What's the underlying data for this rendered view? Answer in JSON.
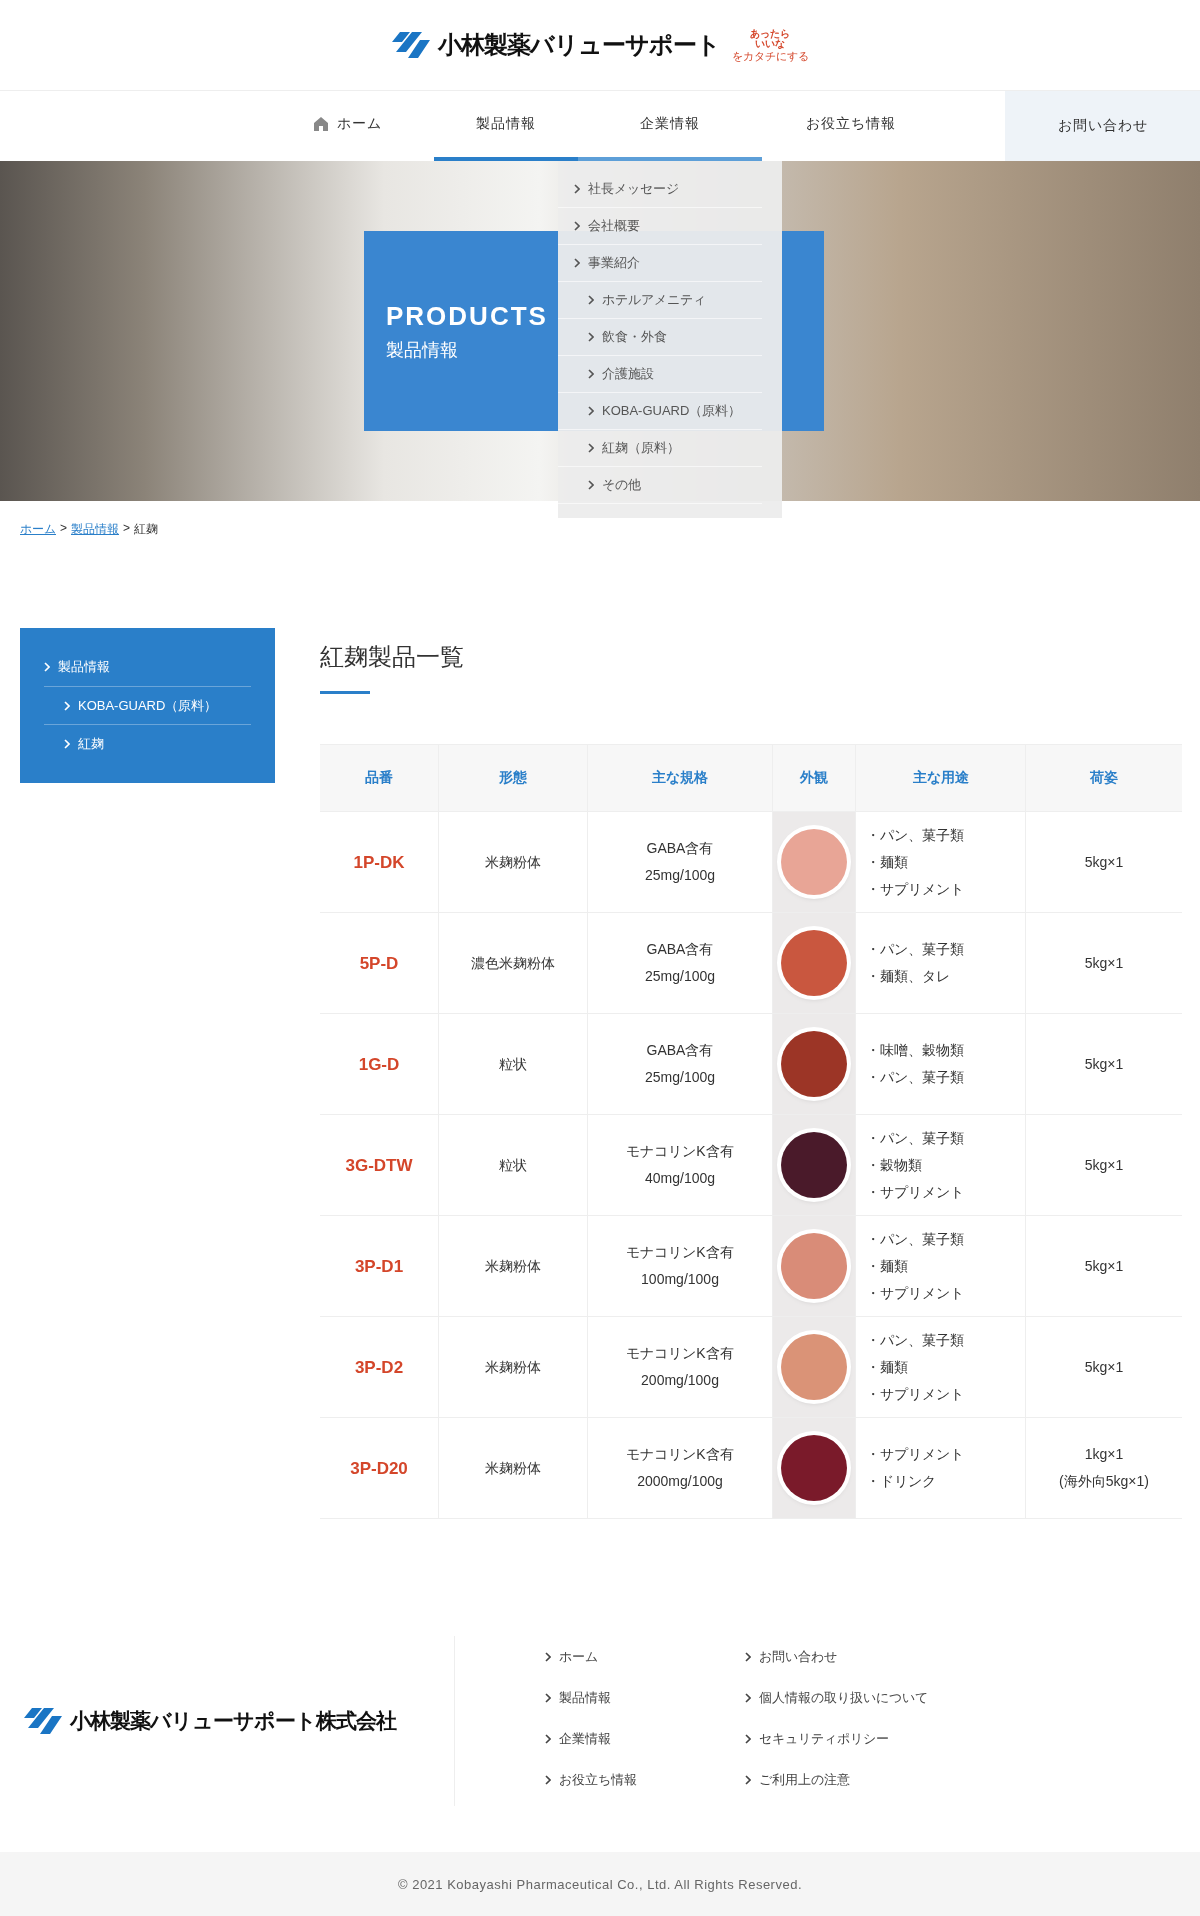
{
  "header": {
    "logo_text": "小林製薬バリューサポート",
    "badge_lines": [
      "あったら",
      "いいな",
      "をカタチにする"
    ]
  },
  "nav": {
    "items": [
      {
        "label": "ホーム",
        "kind": "home",
        "selected": false,
        "expanded": false
      },
      {
        "label": "製品情報",
        "kind": "link",
        "selected": true,
        "expanded": false
      },
      {
        "label": "企業情報",
        "kind": "link",
        "selected": false,
        "expanded": true
      },
      {
        "label": "お役立ち情報",
        "kind": "link",
        "selected": false,
        "expanded": false
      }
    ],
    "contact": "お問い合わせ",
    "dropdown": [
      {
        "label": "社長メッセージ"
      },
      {
        "label": "会社概要"
      },
      {
        "label": "事業紹介",
        "children": [
          {
            "label": "ホテルアメニティ"
          },
          {
            "label": "飲食・外食"
          },
          {
            "label": "介護施設"
          },
          {
            "label": "KOBA-GUARD（原料）"
          },
          {
            "label": "紅麹（原料）"
          },
          {
            "label": "その他"
          }
        ]
      }
    ]
  },
  "hero": {
    "title": "PRODUCTS",
    "subtitle": "製品情報"
  },
  "breadcrumb": {
    "separator": ">",
    "items": [
      {
        "label": "ホーム",
        "link": true
      },
      {
        "label": "製品情報",
        "link": true
      },
      {
        "label": "紅麹",
        "link": false
      }
    ]
  },
  "sidebar": {
    "items": [
      {
        "label": "製品情報",
        "children": [
          {
            "label": "KOBA-GUARD（原料）"
          },
          {
            "label": "紅麹"
          }
        ]
      }
    ]
  },
  "page_title": "紅麹製品一覧",
  "table": {
    "columns": [
      "品番",
      "形態",
      "主な規格",
      "外観",
      "主な用途",
      "荷姿"
    ],
    "rows": [
      {
        "code": "1P-DK",
        "form": "米麹粉体",
        "spec": [
          "GABA含有",
          "25mg/100g"
        ],
        "color": "#e8a596",
        "uses": [
          "・パン、菓子類",
          "・麺類",
          "・サプリメント"
        ],
        "packing": [
          "5kg×1"
        ]
      },
      {
        "code": "5P-D",
        "form": "濃色米麹粉体",
        "spec": [
          "GABA含有",
          "25mg/100g"
        ],
        "color": "#c9573f",
        "uses": [
          "・パン、菓子類",
          "・麺類、タレ"
        ],
        "packing": [
          "5kg×1"
        ]
      },
      {
        "code": "1G-D",
        "form": "粒状",
        "spec": [
          "GABA含有",
          "25mg/100g"
        ],
        "color": "#9c3526",
        "uses": [
          "・味噌、穀物類",
          "・パン、菓子類"
        ],
        "packing": [
          "5kg×1"
        ]
      },
      {
        "code": "3G-DTW",
        "form": "粒状",
        "spec": [
          "モナコリンK含有",
          "40mg/100g"
        ],
        "color": "#4a1a2a",
        "uses": [
          "・パン、菓子類",
          "・穀物類",
          "・サプリメント"
        ],
        "packing": [
          "5kg×1"
        ]
      },
      {
        "code": "3P-D1",
        "form": "米麹粉体",
        "spec": [
          "モナコリンK含有",
          "100mg/100g"
        ],
        "color": "#d98c78",
        "uses": [
          "・パン、菓子類",
          "・麺類",
          "・サプリメント"
        ],
        "packing": [
          "5kg×1"
        ]
      },
      {
        "code": "3P-D2",
        "form": "米麹粉体",
        "spec": [
          "モナコリンK含有",
          "200mg/100g"
        ],
        "color": "#da9377",
        "uses": [
          "・パン、菓子類",
          "・麺類",
          "・サプリメント"
        ],
        "packing": [
          "5kg×1"
        ]
      },
      {
        "code": "3P-D20",
        "form": "米麹粉体",
        "spec": [
          "モナコリンK含有",
          "2000mg/100g"
        ],
        "color": "#7a1a2a",
        "uses": [
          "・サプリメント",
          "・ドリンク"
        ],
        "packing": [
          "1kg×1",
          "(海外向5kg×1)"
        ]
      }
    ]
  },
  "footer": {
    "company": "小林製薬バリューサポート株式会社",
    "links": [
      [
        "ホーム",
        "製品情報",
        "企業情報",
        "お役立ち情報"
      ],
      [
        "お問い合わせ",
        "個人情報の取り扱いについて",
        "セキュリティポリシー",
        "ご利用上の注意"
      ]
    ],
    "copyright": "© 2021 Kobayashi Pharmaceutical Co., Ltd. All Rights Reserved."
  }
}
